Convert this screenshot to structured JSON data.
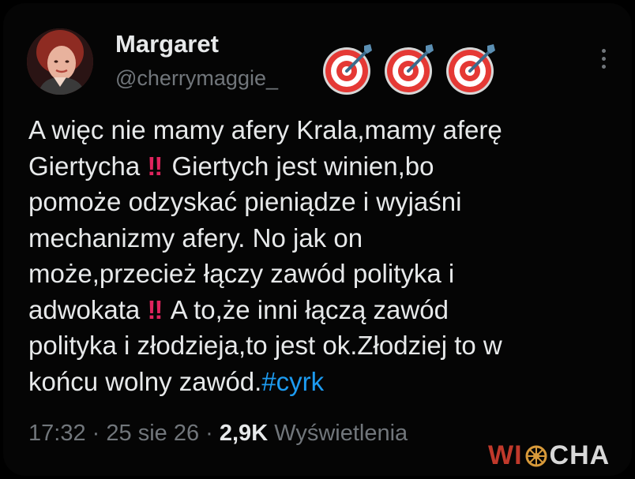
{
  "tweet": {
    "author_name": "Margaret",
    "author_handle": "@cherrymaggie_",
    "emoji_row": [
      "direct-hit-emoji",
      "direct-hit-emoji",
      "direct-hit-emoji"
    ],
    "body_lines": [
      {
        "text": "A więc nie mamy afery Krala,mamy aferę"
      },
      {
        "pre": "Giertycha ",
        "mark": "‼",
        "post": " Giertych jest winien,bo"
      },
      {
        "text": "pomoże odzyskać pieniądze i wyjaśni"
      },
      {
        "text": "mechanizmy afery. No jak on"
      },
      {
        "text": "może,przecież łączy zawód polityka i"
      },
      {
        "pre": "adwokata ",
        "mark": "‼",
        "post": " A to,że inni łączą zawód"
      },
      {
        "text": "polityka i złodzieja,to jest ok.Złodziej to w"
      },
      {
        "pre": "końcu wolny zawód.",
        "hashtag": "#cyrk"
      }
    ],
    "time": "17:32",
    "separator": "·",
    "date": "25 sie 26",
    "views_count": "2,9K",
    "views_label": "Wyświetlenia"
  },
  "watermark": {
    "prefix": "WI",
    "suffix": "CHA"
  },
  "colors": {
    "background": "#000000",
    "text": "#e7e9ea",
    "secondary": "#71767b",
    "link": "#1d9bf0",
    "exclamation": "#e0245e"
  }
}
